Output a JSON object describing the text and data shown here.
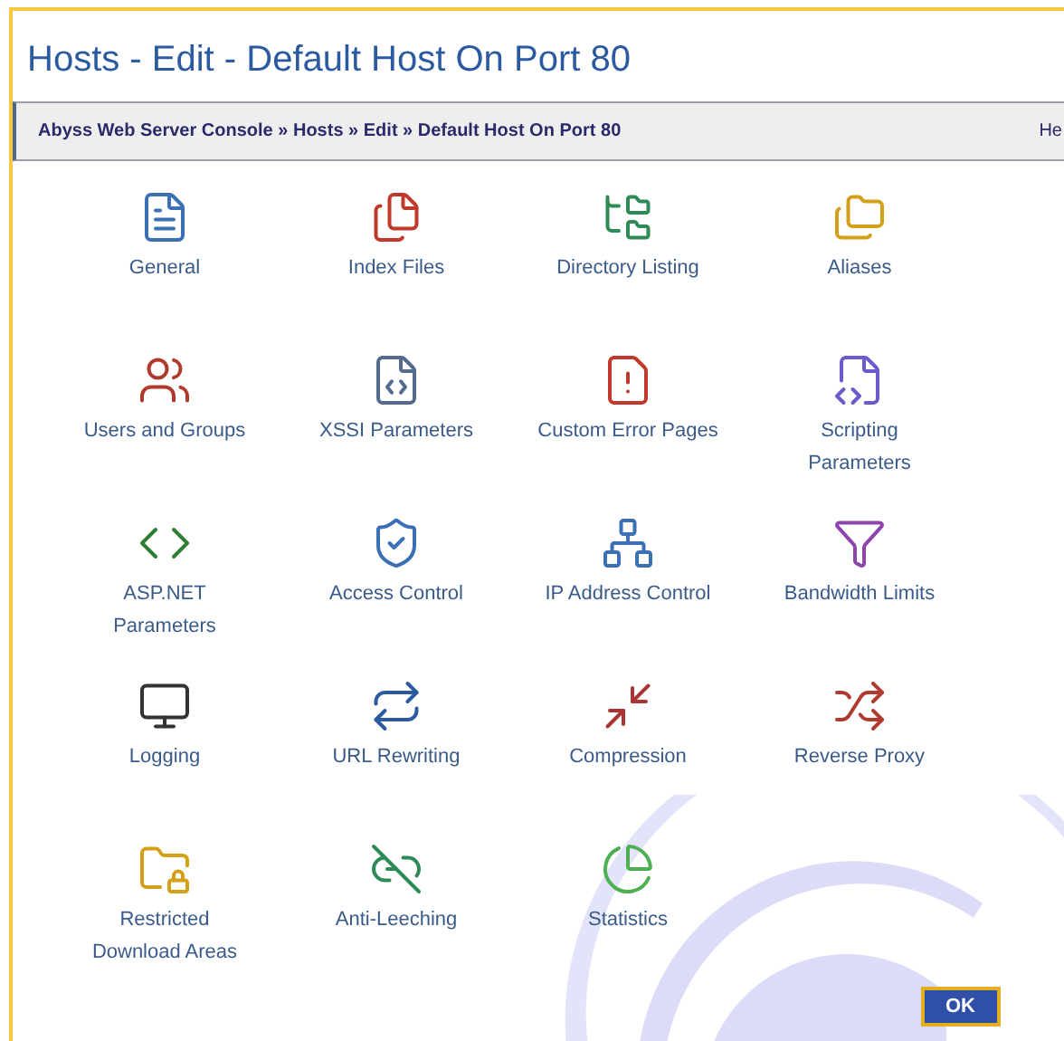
{
  "window": {
    "title": "Hosts - Edit - Default Host On Port 80"
  },
  "breadcrumb": {
    "path": "Abyss Web Server Console » Hosts » Edit » Default Host On Port 80",
    "help": "He"
  },
  "items": [
    {
      "label": "General"
    },
    {
      "label": "Index Files"
    },
    {
      "label": "Directory Listing"
    },
    {
      "label": "Aliases"
    },
    {
      "label": "Users and Groups"
    },
    {
      "label": "XSSI Parameters"
    },
    {
      "label": "Custom Error Pages"
    },
    {
      "label": "Scripting Parameters"
    },
    {
      "label": "ASP.NET Parameters"
    },
    {
      "label": "Access Control"
    },
    {
      "label": "IP Address Control"
    },
    {
      "label": "Bandwidth Limits"
    },
    {
      "label": "Logging"
    },
    {
      "label": "URL Rewriting"
    },
    {
      "label": "Compression"
    },
    {
      "label": "Reverse Proxy"
    },
    {
      "label": "Restricted Download Areas"
    },
    {
      "label": "Anti-Leeching"
    },
    {
      "label": "Statistics"
    }
  ],
  "buttons": [
    {
      "label": "OK"
    }
  ]
}
